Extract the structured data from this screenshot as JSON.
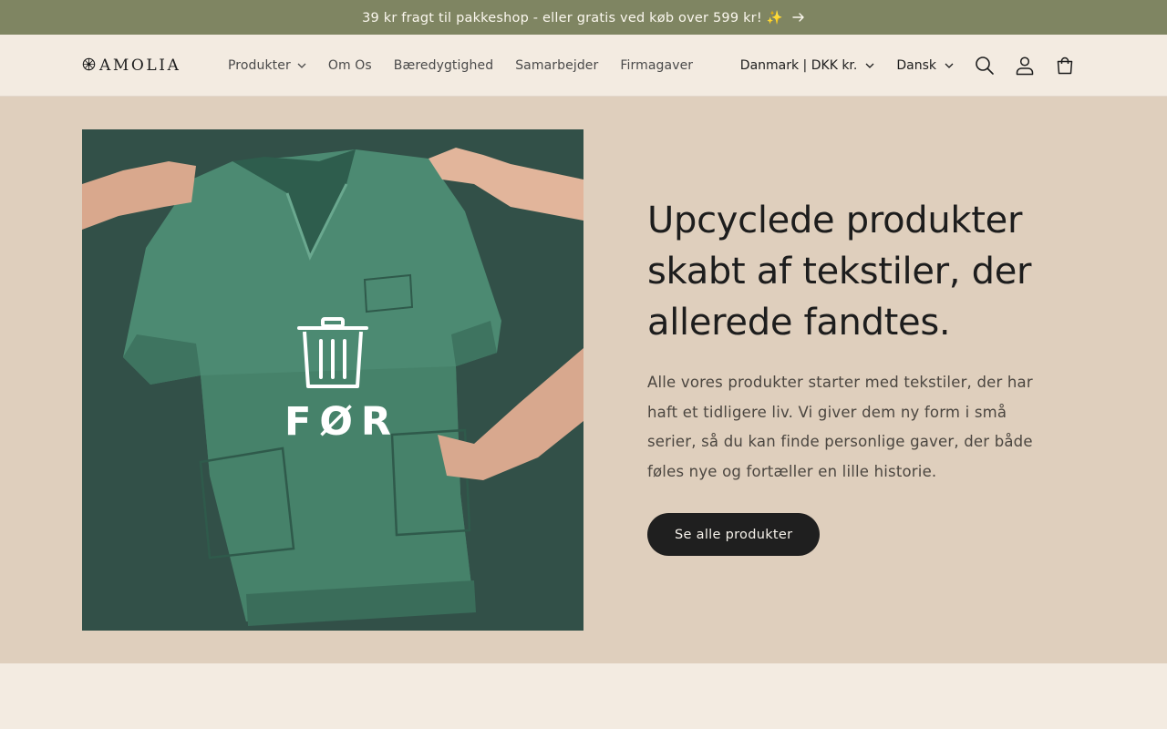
{
  "announcement": {
    "text": "39 kr fragt til pakkeshop - eller gratis ved køb over 599 kr! ✨",
    "arrow_icon": "arrow-right-icon"
  },
  "header": {
    "logo_text": "AMOLIA",
    "nav": [
      {
        "label": "Produkter",
        "has_dropdown": true
      },
      {
        "label": "Om Os"
      },
      {
        "label": "Bæredygtighed"
      },
      {
        "label": "Samarbejder"
      },
      {
        "label": "Firmagaver"
      }
    ],
    "country_selector": "Danmark | DKK kr.",
    "language_selector": "Dansk",
    "icons": [
      "search-icon",
      "account-icon",
      "cart-icon"
    ]
  },
  "hero": {
    "image_overlay_text": "FØR",
    "title": "Upcyclede produkter skabt af tekstiler, der allerede fandtes.",
    "description": "Alle vores produkter starter med tekstiler, der har haft et tidligere liv. Vi giver dem ny form i små serier, så du kan finde personlige gaver, der både føles nye og fortæller en lille historie.",
    "cta_label": "Se alle produkter"
  },
  "colors": {
    "announcement_bg": "#7f8562",
    "header_bg": "#f3ebe1",
    "hero_bg": "#dfcfbd",
    "button_bg": "#1f1f1f"
  }
}
